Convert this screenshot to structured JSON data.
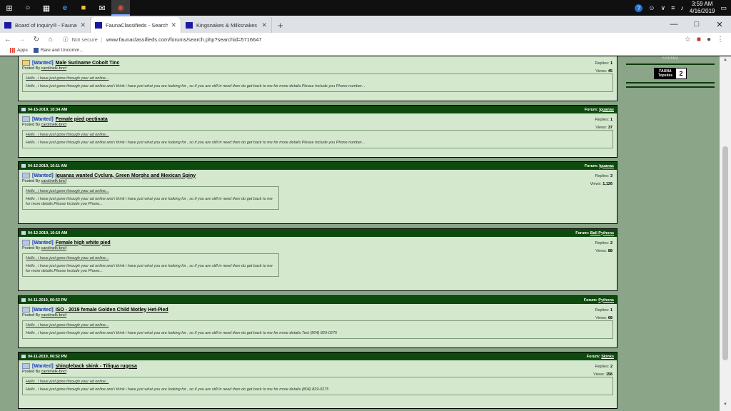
{
  "taskbar": {
    "time": "3:59 AM",
    "date": "4/16/2019"
  },
  "tabs": [
    {
      "label": "Board of Inquiry® - FaunaClassifi"
    },
    {
      "label": "FaunaClassifieds - Search Results"
    },
    {
      "label": "Kingsnakes & Milksnakes - Fauna"
    }
  ],
  "toolbar": {
    "not_secure": "Not secure",
    "url": "www.faunaclassifieds.com/forums/search.php?searchid=5716647"
  },
  "bookmarks": [
    {
      "label": "Apps"
    },
    {
      "label": "Rare and Uncomm..."
    }
  ],
  "sidebar": {
    "top_text": "FAUNAI",
    "badge_brand": "FAUNA",
    "badge_sub": "Topsites",
    "badge_num": "2"
  },
  "results": [
    {
      "date": "",
      "forum_label": "",
      "forum": "",
      "wanted": "[Wanted]",
      "title": "Male Suriname Cobolt Tinc",
      "posted_by": "Posted By",
      "author": "carolinelk-bncf",
      "replies_label": "Replies:",
      "replies": "1",
      "views_label": "Views:",
      "views": "45",
      "snippet_head": "Hello , i have just gone through your ad online...",
      "snippet": "Hello , i have just gone through your ad online and i think i have just what you are looking for , so if you are still in need then do get back to me for more details.Please Include you Phone number..."
    },
    {
      "date": "04-15-2019, 10:34 AM",
      "forum_label": "Forum:",
      "forum": "Iguanas",
      "wanted": "[Wanted]",
      "title": "Female pied pectinata",
      "posted_by": "Posted By",
      "author": "carolinelk-bncf",
      "replies_label": "Replies:",
      "replies": "1",
      "views_label": "Views:",
      "views": "37",
      "snippet_head": "Hello , i have just gone through your ad online...",
      "snippet": "Hello , i have just gone through your ad online and i think i have just what you are looking for , so if you are still in need then do get back to me for more details.Please Include you Phone number..."
    },
    {
      "date": "04-12-2019, 10:11 AM",
      "forum_label": "Forum:",
      "forum": "Iguanas",
      "wanted": "[Wanted]",
      "title": "Iguanas wanted Cyclura, Green Morphs and Mexican Spiny",
      "posted_by": "Posted By",
      "author": "carolinelk-bncf",
      "replies_label": "Replies:",
      "replies": "3",
      "views_label": "Views:",
      "views": "1,126",
      "snippet_head": "Hello , i have just gone through your ad online...",
      "snippet": "Hello , i have just gone through your ad online and i think i have just what you are looking for , so if you are still in need then do get back to me for more details.Please Include you Phone..."
    },
    {
      "date": "04-12-2019, 10:10 AM",
      "forum_label": "Forum:",
      "forum": "Ball Pythons",
      "wanted": "[Wanted]",
      "title": "Female high white pied",
      "posted_by": "Posted By",
      "author": "carolinelk-bncf",
      "replies_label": "Replies:",
      "replies": "2",
      "views_label": "Views:",
      "views": "88",
      "snippet_head": "Hello , i have just gone through your ad online...",
      "snippet": "Hello , i have just gone through your ad online and i think i have just what you are looking for , so if you are still in need then do get back to me for more details.Please Include you Phone..."
    },
    {
      "date": "04-11-2019, 06:53 PM",
      "forum_label": "Forum:",
      "forum": "Pythons",
      "wanted": "[Wanted]",
      "title": "ISO - 2019 female Golden Child Motley Het-Pied",
      "posted_by": "Posted By",
      "author": "carolinelk-bncf",
      "replies_label": "Replies:",
      "replies": "1",
      "views_label": "Views:",
      "views": "68",
      "snippet_head": "Hello , i have just gone through your ad online...",
      "snippet": "Hello , i have just gone through your ad online and i think i have just what you are looking for , so if you are still in need then do get back to me for more details.Text (804) 829-0275"
    },
    {
      "date": "04-11-2019, 06:52 PM",
      "forum_label": "Forum:",
      "forum": "Skinks",
      "wanted": "[Wanted]",
      "title": "shingleback skink - Tiliqua rugosa",
      "posted_by": "Posted By",
      "author": "carolinelk-bncf",
      "replies_label": "Replies:",
      "replies": "2",
      "views_label": "Views:",
      "views": "158",
      "snippet_head": "Hello , i have just gone through your ad online...",
      "snippet": "Hello , i have just gone through your ad online and i think i have just what you are looking for , so if you are still in need then do get back to me for more details.(804) 829-0275"
    }
  ]
}
